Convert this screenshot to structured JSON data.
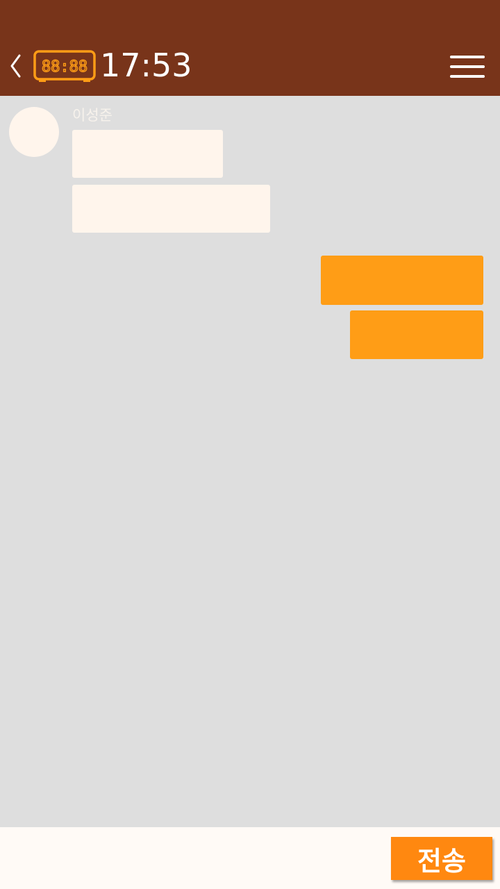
{
  "header": {
    "back_icon": "chevron-left-icon",
    "clock_icon": "digital-clock-icon",
    "clock_digits": "88:88",
    "time": "17:53",
    "menu_icon": "hamburger-menu-icon",
    "background_color": "#78341a"
  },
  "chat": {
    "background_color": "#dedede",
    "received": {
      "sender_name": "이성준",
      "avatar_color": "#fff5ec",
      "bubble_color": "#fff5ec",
      "message_count": 2
    },
    "sent": {
      "bubble_color": "#ff9d16",
      "message_count": 2
    }
  },
  "input_bar": {
    "input_value": "",
    "send_label": "전송",
    "send_button_color": "#ff8810"
  },
  "colors": {
    "accent": "#ff9d16",
    "header_brown": "#78341a"
  }
}
